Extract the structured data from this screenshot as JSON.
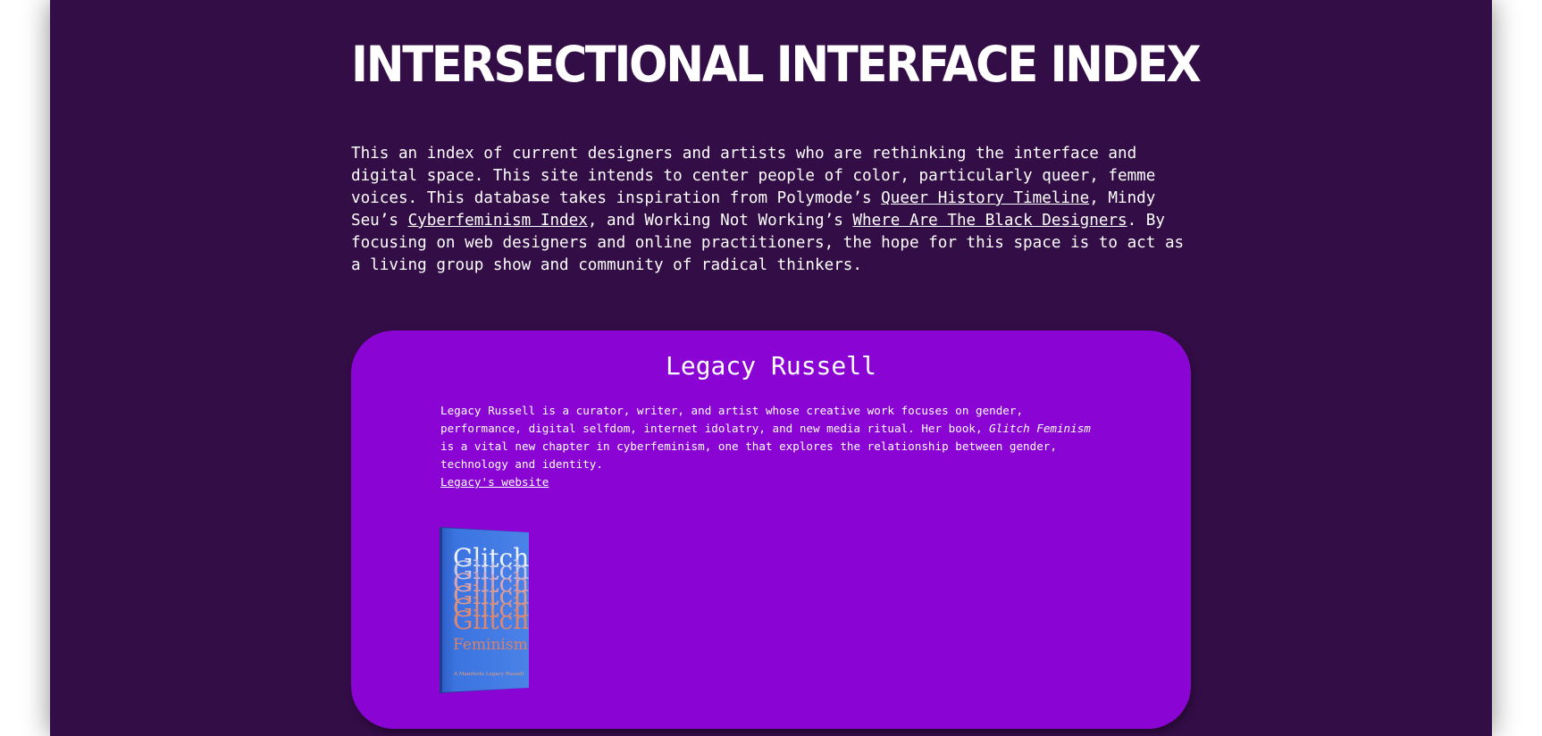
{
  "header": {
    "title": "INTERSECTIONAL INTERFACE INDEX"
  },
  "intro": {
    "text_1": "This an index of current designers and artists who are rethinking the interface and digital space. This site intends to center people of color, particularly queer, femme voices. This database takes inspiration from Polymode’s ",
    "link_1": "Queer History Timeline",
    "text_2": ", Mindy Seu’s ",
    "link_2": "Cyberfeminism Index",
    "text_3": ", and Working Not Working’s ",
    "link_3": "Where Are The Black Designers",
    "text_4": ". By focusing on web designers and online practitioners, the hope for this space is to act as a living group show and community of radical thinkers."
  },
  "entries": [
    {
      "name": "Legacy Russell",
      "bio_1": "Legacy Russell is a curator, writer, and artist whose creative work focuses on gender, performance, digital selfdom, internet idolatry, and new media ritual. Her book, ",
      "bio_book": "Glitch Feminism",
      "bio_2": " is a vital new chapter in cyberfeminism, one that explores the relationship between gender, technology and identity.",
      "website_label": "Legacy's website",
      "book_cover": {
        "title_word": "Glitch",
        "title_word_2": "Feminism",
        "subtitle": "A Manifesto  Legacy Russell",
        "cover_color": "#3b74e0",
        "text_color": "#e8eef8",
        "accent_color": "#d9826a"
      }
    }
  ],
  "colors": {
    "page_background": "#330d46",
    "card_background": "#8a04d4",
    "text": "#ffffff"
  }
}
